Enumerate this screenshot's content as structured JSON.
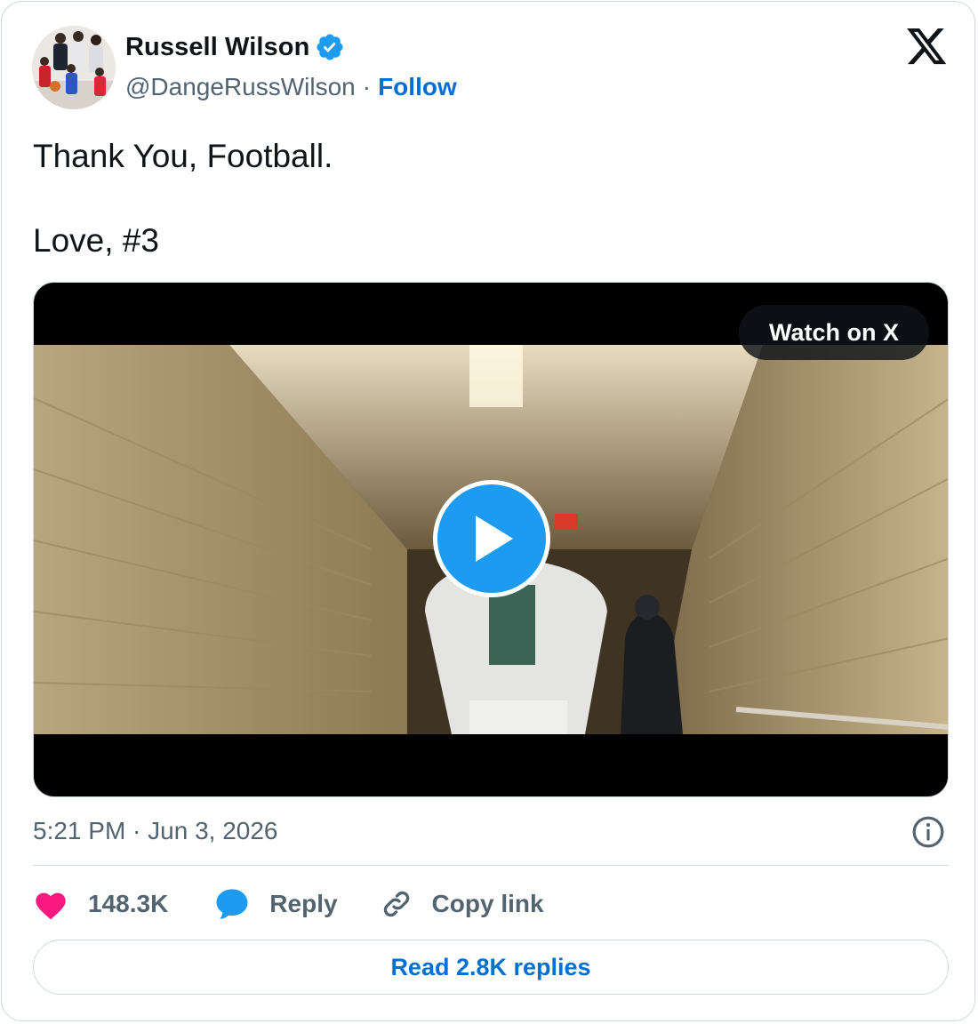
{
  "author": {
    "display_name": "Russell Wilson",
    "handle": "@DangeRussWilson",
    "follow_label": "Follow",
    "verified": true
  },
  "tweet": {
    "lines": [
      "Thank You, Football.",
      "Love, #3"
    ]
  },
  "media": {
    "watch_label": "Watch on X",
    "type": "video"
  },
  "meta": {
    "separator": "·",
    "timestamp": "5:21 PM · Jun 3, 2026"
  },
  "actions": {
    "likes": "148.3K",
    "reply_label": "Reply",
    "copy_label": "Copy link"
  },
  "replies_button": "Read 2.8K replies",
  "colors": {
    "link": "#006fd6",
    "verified": "#1d9bf0",
    "heart": "#f91880",
    "play": "#1d9bf0",
    "muted": "#536471"
  }
}
